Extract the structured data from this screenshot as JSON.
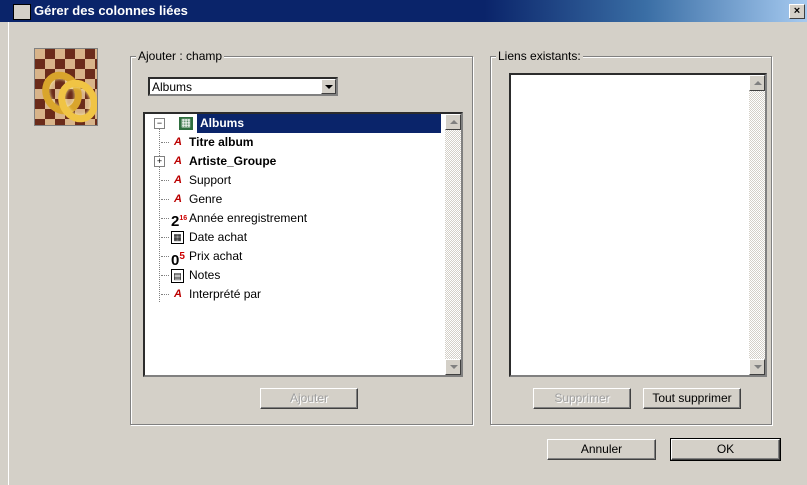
{
  "window": {
    "title": "Gérer des colonnes liées",
    "close_label": "×"
  },
  "add_group": {
    "legend": "Ajouter : champ",
    "table_select": {
      "value": "Albums"
    },
    "tree": [
      {
        "label": "Albums",
        "icon": "table-icon",
        "expander": "−",
        "selected": true,
        "bold": true
      },
      {
        "label": "Titre album",
        "icon": "text-field-icon",
        "bold": true
      },
      {
        "label": "Artiste_Groupe",
        "icon": "text-field-icon",
        "expander": "+",
        "bold": true
      },
      {
        "label": "Support",
        "icon": "text-field-icon"
      },
      {
        "label": "Genre",
        "icon": "text-field-icon"
      },
      {
        "label": "Année enregistrement",
        "icon": "integer-field-icon"
      },
      {
        "label": "Date achat",
        "icon": "date-field-icon"
      },
      {
        "label": "Prix achat",
        "icon": "real-field-icon"
      },
      {
        "label": "Notes",
        "icon": "text-block-icon"
      },
      {
        "label": "Interprété par",
        "icon": "text-field-icon"
      }
    ],
    "add_button": "Ajouter"
  },
  "existing_group": {
    "legend": "Liens existants:",
    "delete_button": "Supprimer",
    "delete_all_button": "Tout supprimer"
  },
  "footer": {
    "cancel_button": "Annuler",
    "ok_button": "OK"
  },
  "icon_glyphs": {
    "text": "A",
    "integer": "2",
    "integer_sup": "16",
    "real": "0",
    "real_sup": "5",
    "date": "▦",
    "notes": "▤",
    "table": "▦"
  },
  "colors": {
    "selection": "#0a246a",
    "titlebar": "#0a246a",
    "face": "#d4d0c8"
  }
}
